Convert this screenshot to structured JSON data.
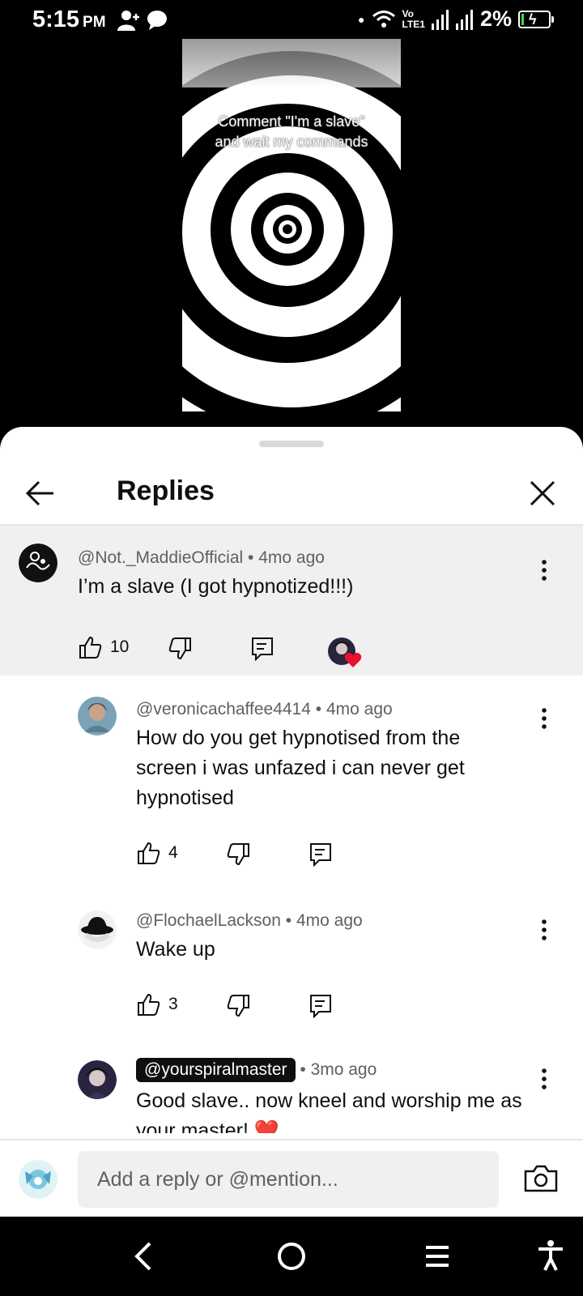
{
  "status_bar": {
    "time": "5:15",
    "ampm": "PM",
    "network_top": "Vo",
    "network_bottom": "LTE1",
    "battery": "2%"
  },
  "video": {
    "overlay_line1": "Comment \"I'm a slave\"",
    "overlay_line2": "and wait my commands"
  },
  "header": {
    "title": "Replies"
  },
  "parent_comment": {
    "author": "@Not._MaddieOfficial",
    "time": "4mo ago",
    "text": "I’m a slave (I got hypnotized!!!)",
    "likes": "10"
  },
  "replies": [
    {
      "author": "@veronicachaffee4414",
      "time": "4mo ago",
      "text": "How do you get hypnotised from the screen i was unfazed i can never get hypnotised",
      "likes": "4"
    },
    {
      "author": "@FlochaelLackson",
      "time": "4mo ago",
      "text": "Wake up",
      "likes": "3"
    },
    {
      "author": "@yourspiralmaster",
      "time": "3mo ago",
      "text": "Good slave.. now kneel and worship me as your master! ❤️"
    }
  ],
  "reply_input": {
    "placeholder": "Add a reply or @mention..."
  },
  "colors": {
    "heart": "#e8112d",
    "tag_bg": "#0f0f0f",
    "highlight_bg": "#f0f0f0"
  }
}
